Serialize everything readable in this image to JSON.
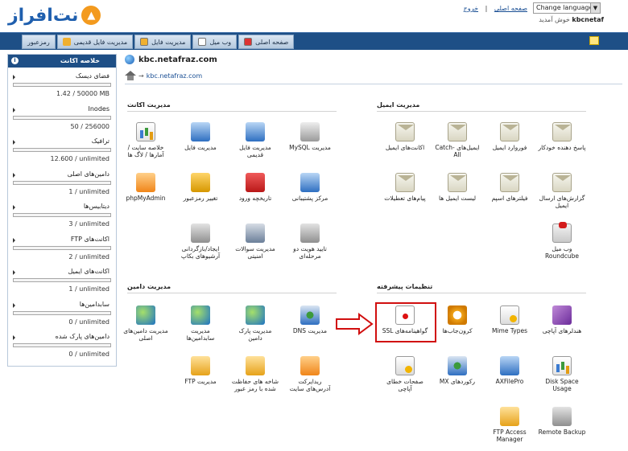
{
  "header": {
    "logo_text": "نت‌افراز",
    "links": {
      "home": "صفحه اصلی",
      "sep": "|",
      "logout": "خروج"
    },
    "language": "Change language...",
    "welcome_user": "kbcnetaf",
    "welcome_text": "خوش آمدید"
  },
  "nav": {
    "tabs": [
      {
        "label": "صفحه اصلی",
        "icon": "home-icon"
      },
      {
        "label": "وب میل",
        "icon": "mail-icon"
      },
      {
        "label": "مدیریت فایل",
        "icon": "folder-icon"
      },
      {
        "label": "مدیریت فایل قدیمی",
        "icon": "folder-icon"
      },
      {
        "label": "رمزعبور",
        "icon": "key-icon"
      }
    ]
  },
  "summary": {
    "title": "خلاصه اکانت",
    "stats": [
      {
        "label": "فضای دیسک",
        "value": "1.42 / 50000 MB",
        "fraction": 0.0
      },
      {
        "label": "Inodes",
        "value": "50 / 256000",
        "fraction": 0.0
      },
      {
        "label": "ترافیک",
        "value": "12.600 / unlimited",
        "fraction": 0.0
      },
      {
        "label": "دامین‌های اصلی",
        "value": "1 / unlimited",
        "fraction": 0.0
      },
      {
        "label": "دیتابیس‌ها",
        "value": "3 / unlimited",
        "fraction": 0.0
      },
      {
        "label": "اکانت‌های FTP",
        "value": "2 / unlimited",
        "fraction": 0.0
      },
      {
        "label": "اکانت‌های ایمیل",
        "value": "1 / unlimited",
        "fraction": 0.0
      },
      {
        "label": "سابدامین‌ها",
        "value": "0 / unlimited",
        "fraction": 0.0
      },
      {
        "label": "دامین‌های پارک شده",
        "value": "0 / unlimited",
        "fraction": 0.0
      }
    ]
  },
  "main": {
    "domain": "kbc.netafraz.com",
    "breadcrumb": "kbc.netafraz.com",
    "sections": {
      "account": {
        "title": "مدیریت اکانت",
        "items": [
          {
            "label": "مدیریت MySQL",
            "icon": "database-icon"
          },
          {
            "label": "مدیریت فایل قدیمی",
            "icon": "old-file-manager-icon"
          },
          {
            "label": "مدیریت فایل",
            "icon": "file-manager-icon"
          },
          {
            "label": "خلاصه سایت / آمارها / لاگ ها",
            "icon": "stats-icon"
          },
          {
            "label": "مرکز پشتیبانی",
            "icon": "support-icon"
          },
          {
            "label": "تاریخچه ورود",
            "icon": "login-history-icon"
          },
          {
            "label": "تغییر رمزعبور",
            "icon": "lock-icon"
          },
          {
            "label": "phpMyAdmin",
            "icon": "phpmyadmin-icon"
          },
          {
            "label": "تایید هویت دو مرحله‌ای",
            "icon": "two-factor-icon"
          },
          {
            "label": "مدیریت سوالات امنیتی",
            "icon": "shield-icon"
          },
          {
            "label": "ایجاد/بازگردانی آرشیوهای بکاپ",
            "icon": "backup-icon"
          }
        ]
      },
      "email": {
        "title": "مدیریت ایمیل",
        "items": [
          {
            "label": "پاسخ دهنده خودکار",
            "icon": "autoresponder-icon"
          },
          {
            "label": "فوروارد ایمیل",
            "icon": "forwarder-icon"
          },
          {
            "label": "ایمیل‌های Catch-All",
            "icon": "catch-all-icon"
          },
          {
            "label": "اکانت‌های ایمیل",
            "icon": "email-accounts-icon"
          },
          {
            "label": "گزارش‌های ارسال ایمیل",
            "icon": "delivery-report-icon"
          },
          {
            "label": "فیلترهای اسپم",
            "icon": "spam-filter-icon"
          },
          {
            "label": "لیست ایمیل ها",
            "icon": "mailing-list-icon"
          },
          {
            "label": "پیام‌های تعطیلات",
            "icon": "vacation-icon"
          },
          {
            "label": "وب میل Roundcube",
            "icon": "webmail-icon"
          }
        ]
      },
      "domain": {
        "title": "مدیریت دامین",
        "items": [
          {
            "label": "مدیریت DNS",
            "icon": "dns-icon"
          },
          {
            "label": "مدیریت پارک دامین",
            "icon": "park-domain-icon"
          },
          {
            "label": "مدیریت سابدامین‌ها",
            "icon": "subdomain-icon"
          },
          {
            "label": "مدیریت دامین‌های اصلی",
            "icon": "domain-icon"
          },
          {
            "label": "ریدایرکت آدرس‌های سایت",
            "icon": "redirect-icon"
          },
          {
            "label": "شاخه های حفاظت شده با رمز عبور",
            "icon": "protected-dir-icon"
          },
          {
            "label": "مدیریت FTP",
            "icon": "ftp-icon"
          }
        ]
      },
      "advanced": {
        "title": "تنظیمات پیشرفته",
        "items": [
          {
            "label": "هندلرهای آپاچی",
            "icon": "apache-handler-icon"
          },
          {
            "label": "Mime Types",
            "icon": "mime-types-icon"
          },
          {
            "label": "کرون‌جاب‌ها",
            "icon": "cron-icon"
          },
          {
            "label": "گواهینامه‌های SSL",
            "icon": "ssl-certificate-icon"
          },
          {
            "label": "Disk Space Usage",
            "icon": "disk-usage-icon"
          },
          {
            "label": "AXFilePro",
            "icon": "axfilepro-icon"
          },
          {
            "label": "رکوردهای MX",
            "icon": "mx-records-icon"
          },
          {
            "label": "صفحات خطای آپاچی",
            "icon": "error-pages-icon"
          },
          {
            "label": "Remote Backup",
            "icon": "remote-backup-icon"
          },
          {
            "label": "FTP Access Manager",
            "icon": "ftp-access-icon"
          }
        ]
      }
    }
  },
  "colors": {
    "nav": "#1e4f86",
    "highlight": "#d10f0f",
    "link": "#1a4f94"
  }
}
